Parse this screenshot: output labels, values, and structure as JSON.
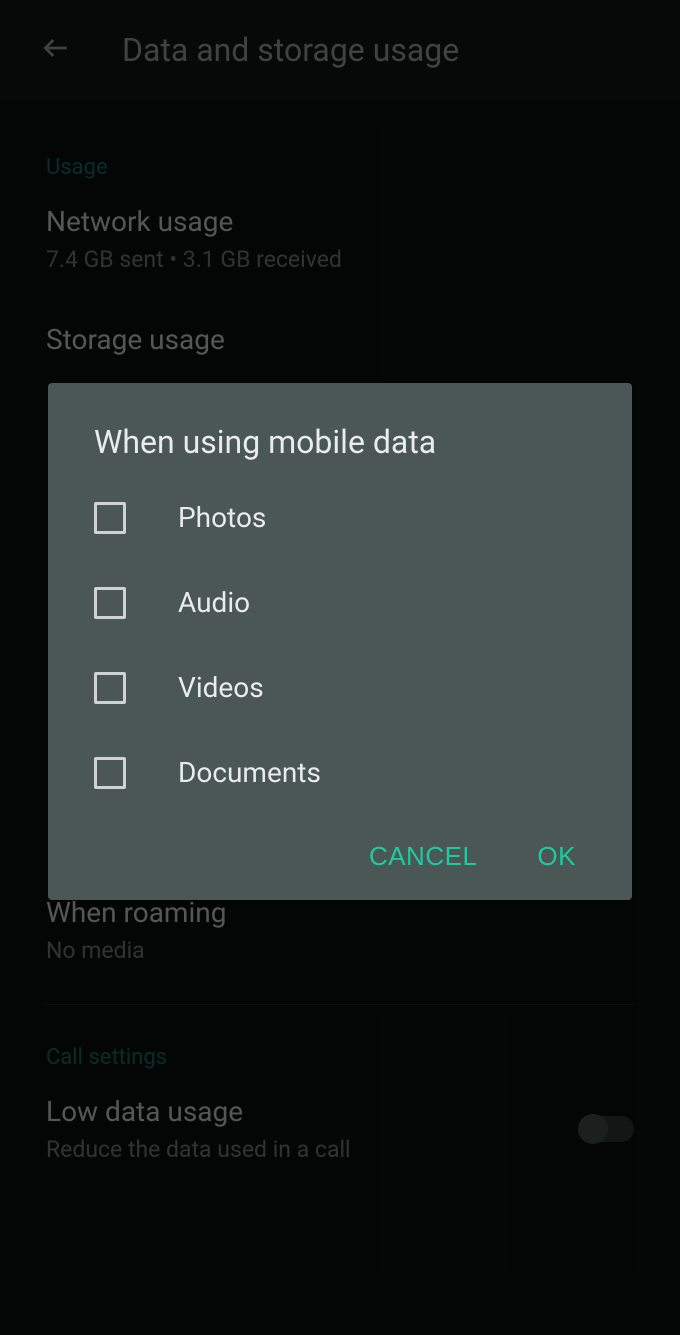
{
  "header": {
    "title": "Data and storage usage"
  },
  "sections": {
    "usage": {
      "header": "Usage",
      "network": {
        "title": "Network usage",
        "subtitle": "7.4 GB sent • 3.1 GB received"
      },
      "storage": {
        "title": "Storage usage"
      }
    },
    "roaming": {
      "title": "When roaming",
      "subtitle": "No media"
    },
    "call": {
      "header": "Call settings",
      "lowdata": {
        "title": "Low data usage",
        "subtitle": "Reduce the data used in a call"
      }
    }
  },
  "dialog": {
    "title": "When using mobile data",
    "options": {
      "photos": "Photos",
      "audio": "Audio",
      "videos": "Videos",
      "documents": "Documents"
    },
    "actions": {
      "cancel": "CANCEL",
      "ok": "OK"
    }
  }
}
